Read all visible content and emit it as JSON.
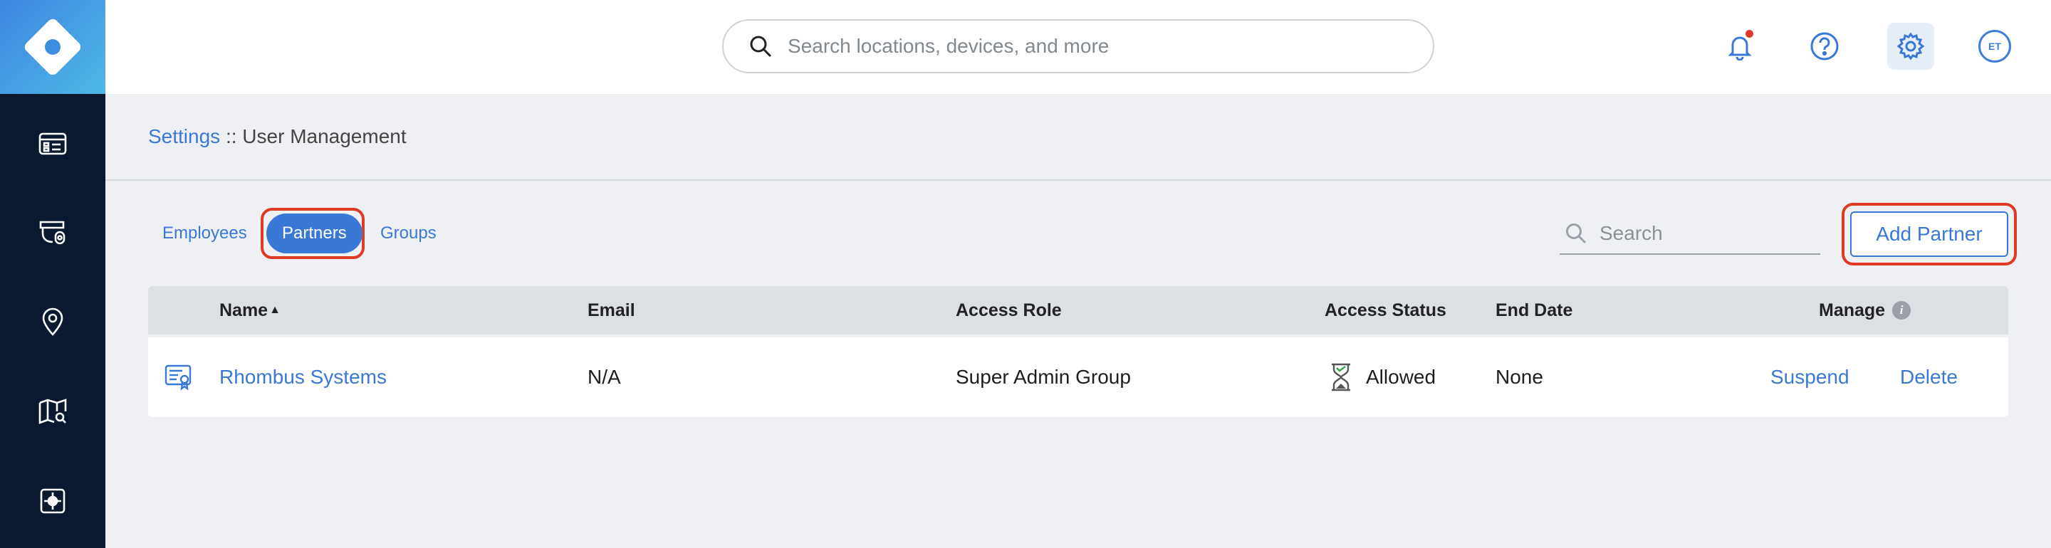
{
  "header": {
    "search_placeholder": "Search locations, devices, and more",
    "avatar_initials": "ET"
  },
  "sidebar": {
    "items": [
      {
        "icon": "dashboard-icon"
      },
      {
        "icon": "camera-icon"
      },
      {
        "icon": "location-pin-icon"
      },
      {
        "icon": "map-search-icon"
      },
      {
        "icon": "integrations-icon"
      }
    ]
  },
  "breadcrumb": {
    "root": "Settings",
    "separator": " :: ",
    "current": "User Management"
  },
  "tabs": [
    {
      "label": "Employees",
      "selected": false
    },
    {
      "label": "Partners",
      "selected": true
    },
    {
      "label": "Groups",
      "selected": false
    }
  ],
  "table_search": {
    "placeholder": "Search"
  },
  "add_button": {
    "label": "Add Partner"
  },
  "table": {
    "columns": {
      "name": "Name",
      "sort_indicator": "▲",
      "email": "Email",
      "access_role": "Access Role",
      "access_status": "Access Status",
      "end_date": "End Date",
      "manage": "Manage"
    },
    "rows": [
      {
        "name": "Rhombus Systems",
        "email": "N/A",
        "access_role": "Super Admin Group",
        "access_status": "Allowed",
        "end_date": "None",
        "actions": {
          "suspend": "Suspend",
          "delete": "Delete"
        }
      }
    ]
  },
  "colors": {
    "accent": "#3a78d6",
    "sidebar": "#0a1930",
    "highlight": "#e03a26",
    "notification": "#e0392b"
  }
}
